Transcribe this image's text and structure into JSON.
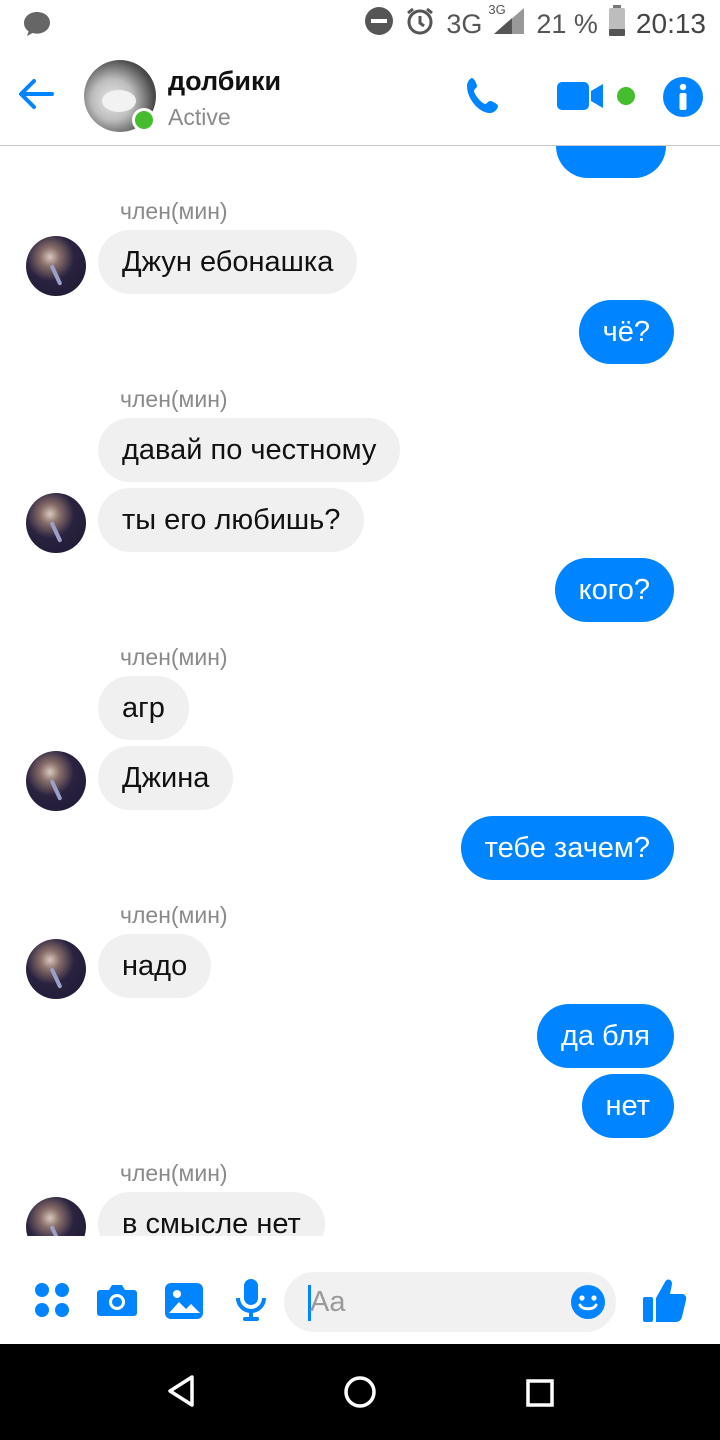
{
  "status_bar": {
    "network": "3G",
    "network_small": "3G",
    "battery_percent": "21 %",
    "time": "20:13"
  },
  "header": {
    "title": "долбики",
    "status": "Active"
  },
  "messages": [
    {
      "id": "m0",
      "direction": "out",
      "text": ""
    },
    {
      "id": "m1",
      "direction": "in",
      "sender": "член(мин)",
      "text": "Джун ебонашка"
    },
    {
      "id": "m2",
      "direction": "out",
      "text": "чё?"
    },
    {
      "id": "m3",
      "direction": "in",
      "sender": "член(мин)",
      "text": "давай по честному"
    },
    {
      "id": "m4",
      "direction": "in",
      "text": "ты его любишь?"
    },
    {
      "id": "m5",
      "direction": "out",
      "text": "кого?"
    },
    {
      "id": "m6",
      "direction": "in",
      "sender": "член(мин)",
      "text": "агр"
    },
    {
      "id": "m7",
      "direction": "in",
      "text": "Джина"
    },
    {
      "id": "m8",
      "direction": "out",
      "text": "тебе зачем?"
    },
    {
      "id": "m9",
      "direction": "in",
      "sender": "член(мин)",
      "text": "надо"
    },
    {
      "id": "m10",
      "direction": "out",
      "text": "да бля"
    },
    {
      "id": "m11",
      "direction": "out",
      "text": "нет"
    },
    {
      "id": "m12",
      "direction": "in",
      "sender": "член(мин)",
      "text": "в смысле нет"
    }
  ],
  "composer": {
    "placeholder": "Aa"
  },
  "colors": {
    "accent": "#0084ff",
    "incoming_bubble": "#f0f0f0",
    "online": "#45bd2e"
  },
  "icons": {
    "status": [
      "messenger-icon",
      "do-not-disturb-icon",
      "alarm-icon",
      "signal-icon",
      "battery-icon"
    ],
    "header": [
      "back-arrow-icon",
      "phone-icon",
      "video-camera-icon",
      "info-icon"
    ],
    "composer": [
      "more-dots-icon",
      "camera-icon",
      "gallery-icon",
      "microphone-icon",
      "emoji-icon",
      "thumbs-up-icon"
    ],
    "nav": [
      "back-triangle-icon",
      "home-circle-icon",
      "recents-square-icon"
    ]
  }
}
